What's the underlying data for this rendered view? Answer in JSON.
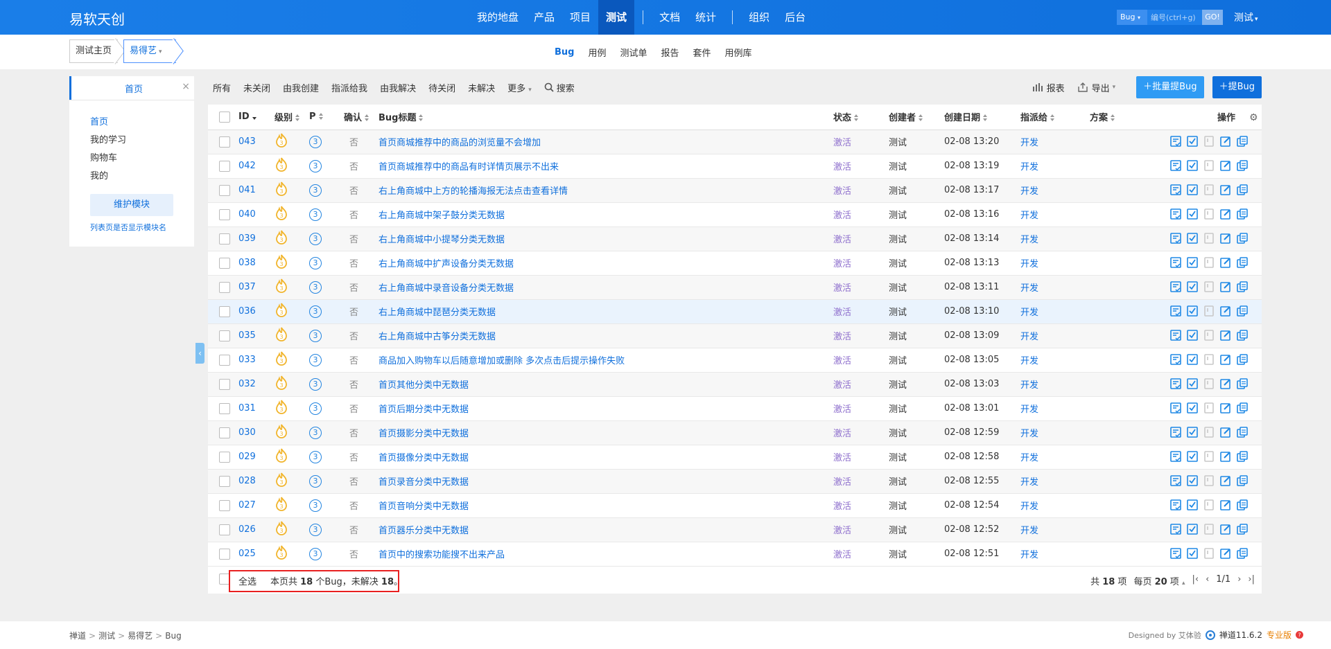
{
  "header": {
    "brand": "易软天创",
    "nav": [
      {
        "label": "我的地盘",
        "active": false
      },
      {
        "label": "产品",
        "active": false
      },
      {
        "label": "项目",
        "active": false
      },
      {
        "label": "测试",
        "active": true
      },
      {
        "label": "文档",
        "active": false
      },
      {
        "label": "统计",
        "active": false
      },
      {
        "label": "组织",
        "active": false
      },
      {
        "label": "后台",
        "active": false
      }
    ],
    "search_type": "Bug",
    "search_placeholder": "编号(ctrl+g)",
    "search_go": "GO!",
    "user": "测试"
  },
  "subheader": {
    "crumb_home": "测试主页",
    "crumb_product": "易得艺",
    "tabs": [
      {
        "label": "Bug",
        "active": true
      },
      {
        "label": "用例",
        "active": false
      },
      {
        "label": "测试单",
        "active": false
      },
      {
        "label": "报告",
        "active": false
      },
      {
        "label": "套件",
        "active": false
      },
      {
        "label": "用例库",
        "active": false
      }
    ]
  },
  "sidebar": {
    "tab_label": "首页",
    "close": "×",
    "items": [
      {
        "label": "首页",
        "active": true
      },
      {
        "label": "我的学习",
        "active": false
      },
      {
        "label": "购物车",
        "active": false
      },
      {
        "label": "我的",
        "active": false
      }
    ],
    "maintain_button": "维护模块",
    "show_module_link": "列表页是否显示模块名"
  },
  "toolbar": {
    "filters": [
      "所有",
      "未关闭",
      "由我创建",
      "指派给我",
      "由我解决",
      "待关闭",
      "未解决",
      "更多"
    ],
    "search": "搜索",
    "report": "报表",
    "export": "导出",
    "batch_create": "批量提Bug",
    "create": "提Bug"
  },
  "table": {
    "headers": {
      "id": "ID",
      "severity": "级别",
      "pri": "P",
      "confirm": "确认",
      "title": "Bug标题",
      "status": "状态",
      "creator": "创建者",
      "date": "创建日期",
      "assigned": "指派给",
      "resolution": "方案",
      "actions": "操作"
    },
    "rows": [
      {
        "id": "043",
        "pri": "3",
        "confirm": "否",
        "title": "首页商城推荐中的商品的浏览量不会增加",
        "status": "激活",
        "creator": "测试",
        "date": "02-08 13:20",
        "assigned": "开发"
      },
      {
        "id": "042",
        "pri": "3",
        "confirm": "否",
        "title": "首页商城推荐中的商品有时详情页展示不出来",
        "status": "激活",
        "creator": "测试",
        "date": "02-08 13:19",
        "assigned": "开发"
      },
      {
        "id": "041",
        "pri": "3",
        "confirm": "否",
        "title": "右上角商城中上方的轮播海报无法点击查看详情",
        "status": "激活",
        "creator": "测试",
        "date": "02-08 13:17",
        "assigned": "开发"
      },
      {
        "id": "040",
        "pri": "3",
        "confirm": "否",
        "title": "右上角商城中架子鼓分类无数据",
        "status": "激活",
        "creator": "测试",
        "date": "02-08 13:16",
        "assigned": "开发"
      },
      {
        "id": "039",
        "pri": "3",
        "confirm": "否",
        "title": "右上角商城中小提琴分类无数据",
        "status": "激活",
        "creator": "测试",
        "date": "02-08 13:14",
        "assigned": "开发"
      },
      {
        "id": "038",
        "pri": "3",
        "confirm": "否",
        "title": "右上角商城中扩声设备分类无数据",
        "status": "激活",
        "creator": "测试",
        "date": "02-08 13:13",
        "assigned": "开发"
      },
      {
        "id": "037",
        "pri": "3",
        "confirm": "否",
        "title": "右上角商城中录音设备分类无数据",
        "status": "激活",
        "creator": "测试",
        "date": "02-08 13:11",
        "assigned": "开发"
      },
      {
        "id": "036",
        "pri": "3",
        "confirm": "否",
        "title": "右上角商城中琵琶分类无数据",
        "status": "激活",
        "creator": "测试",
        "date": "02-08 13:10",
        "assigned": "开发"
      },
      {
        "id": "035",
        "pri": "3",
        "confirm": "否",
        "title": "右上角商城中古筝分类无数据",
        "status": "激活",
        "creator": "测试",
        "date": "02-08 13:09",
        "assigned": "开发"
      },
      {
        "id": "033",
        "pri": "3",
        "confirm": "否",
        "title": "商品加入购物车以后随意增加或删除 多次点击后提示操作失败",
        "status": "激活",
        "creator": "测试",
        "date": "02-08 13:05",
        "assigned": "开发"
      },
      {
        "id": "032",
        "pri": "3",
        "confirm": "否",
        "title": "首页其他分类中无数据",
        "status": "激活",
        "creator": "测试",
        "date": "02-08 13:03",
        "assigned": "开发"
      },
      {
        "id": "031",
        "pri": "3",
        "confirm": "否",
        "title": "首页后期分类中无数据",
        "status": "激活",
        "creator": "测试",
        "date": "02-08 13:01",
        "assigned": "开发"
      },
      {
        "id": "030",
        "pri": "3",
        "confirm": "否",
        "title": "首页摄影分类中无数据",
        "status": "激活",
        "creator": "测试",
        "date": "02-08 12:59",
        "assigned": "开发"
      },
      {
        "id": "029",
        "pri": "3",
        "confirm": "否",
        "title": "首页摄像分类中无数据",
        "status": "激活",
        "creator": "测试",
        "date": "02-08 12:58",
        "assigned": "开发"
      },
      {
        "id": "028",
        "pri": "3",
        "confirm": "否",
        "title": "首页录音分类中无数据",
        "status": "激活",
        "creator": "测试",
        "date": "02-08 12:55",
        "assigned": "开发"
      },
      {
        "id": "027",
        "pri": "3",
        "confirm": "否",
        "title": "首页音响分类中无数据",
        "status": "激活",
        "creator": "测试",
        "date": "02-08 12:54",
        "assigned": "开发"
      },
      {
        "id": "026",
        "pri": "3",
        "confirm": "否",
        "title": "首页器乐分类中无数据",
        "status": "激活",
        "creator": "测试",
        "date": "02-08 12:52",
        "assigned": "开发"
      },
      {
        "id": "025",
        "pri": "3",
        "confirm": "否",
        "title": "首页中的搜索功能搜不出来产品",
        "status": "激活",
        "creator": "测试",
        "date": "02-08 12:51",
        "assigned": "开发"
      }
    ],
    "highlighted_row": "036"
  },
  "footer": {
    "select_all": "全选",
    "summary_prefix": "本页共 ",
    "summary_count": "18",
    "summary_mid": " 个Bug，未解决 ",
    "summary_unresolved": "18",
    "summary_suffix": "。",
    "total_prefix": "共 ",
    "total": "18",
    "total_suffix": " 项",
    "per_page_prefix": "每页 ",
    "per_page": "20",
    "per_page_suffix": " 项",
    "page": "1/1"
  },
  "bottombar": {
    "crumbs": [
      "禅道",
      "测试",
      "易得艺",
      "Bug"
    ],
    "designed_by": "Designed by 艾体验",
    "version": "禅道11.6.2",
    "edition": "专业版"
  },
  "colors": {
    "header_bg": "#0f6fdc",
    "link": "#0f6fdc",
    "status_active": "#8e6fcd",
    "summary_highlight_border": "#e82020"
  }
}
